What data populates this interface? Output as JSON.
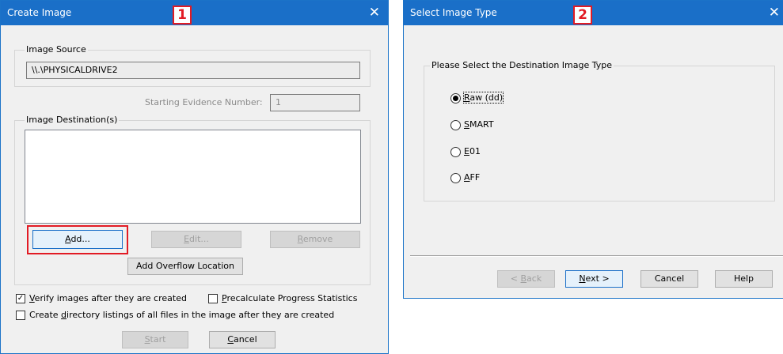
{
  "dialog1": {
    "title": "Create Image",
    "marker": "1",
    "close": "✕",
    "image_source_label": "Image Source",
    "image_source_value": "\\\\.\\PHYSICALDRIVE2",
    "evidence_label": "Starting Evidence Number:",
    "evidence_value": "1",
    "destination_label": "Image Destination(s)",
    "add_prefix": "A",
    "add_rest": "dd...",
    "edit_prefix": "E",
    "edit_rest": "dit...",
    "remove_prefix": "R",
    "remove_rest": "emove",
    "overflow_label": "Add Overflow Location",
    "verify_prefix": "V",
    "verify_rest": "erify images after they are created",
    "verify_checked": true,
    "precalc_prefix": "P",
    "precalc_rest": "recalculate Progress Statistics",
    "precalc_checked": false,
    "dirlist_a": "Create ",
    "dirlist_u": "d",
    "dirlist_b": "irectory listings of all files in the image after they are created",
    "dirlist_checked": false,
    "start_prefix": "S",
    "start_rest": "tart",
    "cancel_prefix": "C",
    "cancel_rest": "ancel"
  },
  "dialog2": {
    "title": "Select Image Type",
    "marker": "2",
    "close": "✕",
    "group_label": "Please Select the Destination Image Type",
    "options": [
      {
        "prefix": "R",
        "rest": "aw (dd)",
        "selected": true
      },
      {
        "prefix": "S",
        "rest": "MART",
        "selected": false
      },
      {
        "prefix": "E",
        "rest": "01",
        "selected": false
      },
      {
        "prefix": "A",
        "rest": "FF",
        "selected": false
      }
    ],
    "back_prefix": "< ",
    "back_u": "B",
    "back_rest": "ack",
    "next_prefix": "N",
    "next_rest": "ext >",
    "cancel_label": "Cancel",
    "help_label": "Help"
  },
  "colors": {
    "titlebar": "#1a6fc8",
    "highlight": "#e21b24"
  }
}
